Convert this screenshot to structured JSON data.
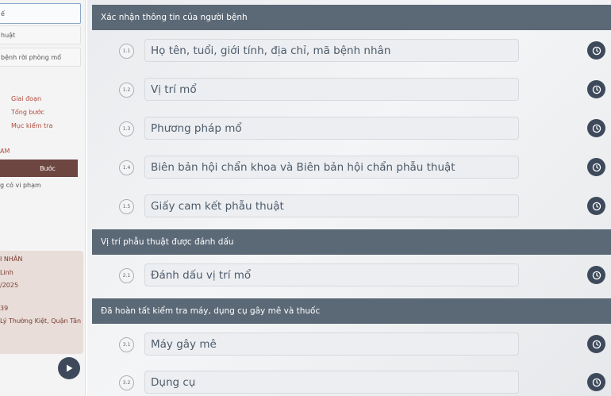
{
  "sidebar": {
    "nav_items": [
      {
        "label": "ế"
      },
      {
        "label": "huật"
      },
      {
        "label": "bệnh rời phòng mổ"
      }
    ],
    "steps": [
      "Giai đoạn",
      "Tổng bước",
      "Mục kiểm tra"
    ],
    "section_label": "AM",
    "step_button": "Bước",
    "violation_text": "g có vi phạm",
    "patient": {
      "heading": "I NHÂN",
      "name": "Linh",
      "date": "/2025",
      "code": "39",
      "address": "Lý Thường Kiệt, Quận Tân"
    }
  },
  "sections": [
    {
      "title": "Xác nhận thông tin của người bệnh",
      "items": [
        {
          "num": "1.1",
          "label": "Họ tên, tuổi, giới tính, địa chỉ, mã bệnh nhân"
        },
        {
          "num": "1.2",
          "label": "Vị trí mổ"
        },
        {
          "num": "1.3",
          "label": "Phương pháp mổ"
        },
        {
          "num": "1.4",
          "label": "Biên bản hội chẩn khoa và Biên bản hội chẩn phẫu thuật"
        },
        {
          "num": "1.5",
          "label": "Giấy cam kết phẫu thuật"
        }
      ]
    },
    {
      "title": "Vị trí phẫu thuật được đánh dấu",
      "items": [
        {
          "num": "2.1",
          "label": "Đánh dấu vị trí mổ"
        }
      ]
    },
    {
      "title": "Đã hoàn tất kiểm tra máy, dụng cụ gây mê và thuốc",
      "items": [
        {
          "num": "3.1",
          "label": "Máy gây mê"
        },
        {
          "num": "3.2",
          "label": "Dụng cụ"
        }
      ]
    }
  ],
  "icons": {
    "row_action": "clock-icon",
    "media": "play-icon"
  },
  "colors": {
    "header": "#5b6876",
    "accent": "#6d4541",
    "icon_button": "#3e4a5b"
  }
}
